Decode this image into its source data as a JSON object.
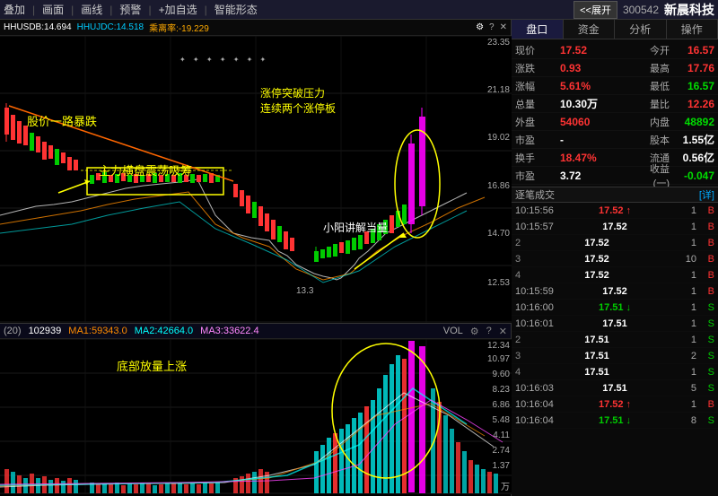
{
  "toolbar": {
    "buttons": [
      "叠加",
      "画面",
      "画线",
      "预警",
      "+加自选",
      "智能形态"
    ],
    "expand": "<<展开",
    "stock_code": "300542",
    "stock_name": "新晨科技"
  },
  "chart_header": {
    "label": "(20)",
    "ma1": "102939",
    "ma2": "MA1:59343.0",
    "ma3": "MA2:42664.0",
    "ma4": "MA3:33622.4",
    "vol_label": "VOL"
  },
  "price_levels": {
    "p1": "23.35",
    "p2": "21.18",
    "p3": "19.02",
    "p4": "16.86",
    "p5": "14.70",
    "p6": "12.53"
  },
  "vol_levels": {
    "v1": "12.34",
    "v2": "10.97",
    "v3": "9.60",
    "v4": "8.23",
    "v5": "6.86",
    "v6": "5.48",
    "v7": "4.11",
    "v8": "2.74",
    "v9": "1.37",
    "v_unit": "万"
  },
  "annotations": {
    "a1": "股价一路暴跌",
    "a2": "主力横盘震荡吸筹",
    "a3": "涨停突破压力\n连续两个涨停板",
    "a4": "小阳讲解当量",
    "a5": "底部放量上涨"
  },
  "header_info": {
    "hhusdb": "HHUSDB:14.694",
    "hhusjdc": "HHUJDC:14.518",
    "lilian": "乘离率:-19.229"
  },
  "right_tabs": {
    "tab1": "盘口",
    "tab2": "资金",
    "tab3": "分析",
    "tab4": "操作"
  },
  "quote": {
    "rows": [
      {
        "label": "现价",
        "val": "17.52",
        "val_class": "val-red",
        "label2": "今开",
        "val2": "16.57",
        "val2_class": "val-red"
      },
      {
        "label": "涨跌",
        "val": "0.93",
        "val_class": "val-red",
        "label2": "最高",
        "val2": "17.76",
        "val2_class": "val-red"
      },
      {
        "label": "涨幅",
        "val": "5.61%",
        "val_class": "val-red",
        "label2": "最低",
        "val2": "16.57",
        "val2_class": "val-green"
      },
      {
        "label": "总量",
        "val": "10.30万",
        "val_class": "val-white",
        "label2": "量比",
        "val2": "12.26",
        "val2_class": "val-red"
      },
      {
        "label": "外盘",
        "val": "54060",
        "val_class": "val-red",
        "label2": "内盘",
        "val2": "48892",
        "val2_class": "val-green"
      },
      {
        "label": "市盈",
        "val": "-",
        "val_class": "val-white",
        "label2": "股本",
        "val2": "1.55亿",
        "val2_class": "val-white"
      },
      {
        "label": "换手",
        "val": "18.47%",
        "val_class": "val-red",
        "label2": "流通",
        "val2": "0.56亿",
        "val2_class": "val-white"
      },
      {
        "label": "市盈",
        "val": "3.72",
        "val_class": "val-white",
        "label2": "收益(一)",
        "val2": "-0.047",
        "val2_class": "val-green"
      }
    ]
  },
  "trade_flow": {
    "header": "逐笔成交",
    "detail": "[详]",
    "rows": [
      {
        "time": "10:15:56",
        "price": "17.52",
        "dir": "up",
        "vol": "1",
        "type": "B",
        "num": ""
      },
      {
        "time": "10:15:57",
        "price": "17.52",
        "dir": "flat",
        "vol": "1",
        "type": "B",
        "num": ""
      },
      {
        "time": "",
        "price": "17.52",
        "dir": "flat",
        "vol": "1",
        "type": "B",
        "num": "2"
      },
      {
        "time": "",
        "price": "17.52",
        "dir": "flat",
        "vol": "10",
        "type": "B",
        "num": "3"
      },
      {
        "time": "",
        "price": "17.52",
        "dir": "flat",
        "vol": "1",
        "type": "B",
        "num": "4"
      },
      {
        "time": "10:15:59",
        "price": "17.52",
        "dir": "flat",
        "vol": "1",
        "type": "B",
        "num": ""
      },
      {
        "time": "10:16:00",
        "price": "17.51",
        "dir": "down",
        "vol": "1",
        "type": "S",
        "num": ""
      },
      {
        "time": "10:16:01",
        "price": "17.51",
        "dir": "flat",
        "vol": "1",
        "type": "S",
        "num": ""
      },
      {
        "time": "",
        "price": "17.51",
        "dir": "flat",
        "vol": "1",
        "type": "S",
        "num": "2"
      },
      {
        "time": "",
        "price": "17.51",
        "dir": "flat",
        "vol": "2",
        "type": "S",
        "num": "3"
      },
      {
        "time": "",
        "price": "17.51",
        "dir": "flat",
        "vol": "1",
        "type": "S",
        "num": "4"
      },
      {
        "time": "10:16:03",
        "price": "17.51",
        "dir": "flat",
        "vol": "5",
        "type": "S",
        "num": ""
      },
      {
        "time": "10:16:04",
        "price": "17.52",
        "dir": "up",
        "vol": "1",
        "type": "B",
        "num": ""
      },
      {
        "time": "10:16:04",
        "price": "17.51",
        "dir": "down",
        "vol": "8",
        "type": "S",
        "num": ""
      }
    ]
  }
}
